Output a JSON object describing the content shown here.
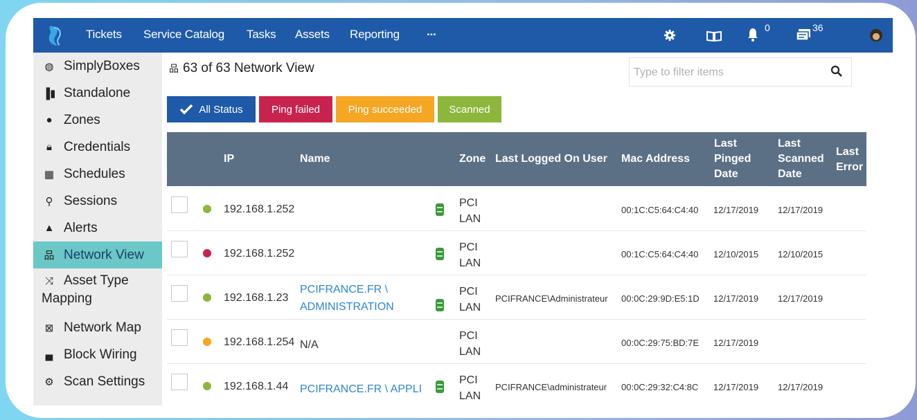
{
  "nav": {
    "items": [
      "Tickets",
      "Service Catalog",
      "Tasks",
      "Assets",
      "Reporting",
      "..."
    ],
    "notifications_count": "0",
    "messages_count": "36"
  },
  "sidebar": {
    "items": [
      {
        "label": "SimplyBoxes",
        "icon": "box-icon"
      },
      {
        "label": "Standalone",
        "icon": "standalone-icon"
      },
      {
        "label": "Zones",
        "icon": "globe-icon"
      },
      {
        "label": "Credentials",
        "icon": "lock-icon"
      },
      {
        "label": "Schedules",
        "icon": "calendar-icon"
      },
      {
        "label": "Sessions",
        "icon": "search-icon"
      },
      {
        "label": "Alerts",
        "icon": "warning-icon"
      },
      {
        "label": "Network View",
        "icon": "network-icon"
      },
      {
        "label": "Asset Type",
        "label2": "Mapping",
        "icon": "shuffle-icon"
      },
      {
        "label": "Network Map",
        "icon": "map-icon"
      },
      {
        "label": "Block Wiring",
        "icon": "switch-icon"
      },
      {
        "label": "Scan Settings",
        "icon": "gear-icon"
      }
    ],
    "active": "Network View"
  },
  "main": {
    "title": "63 of 63 Network View",
    "filter_placeholder": "Type to filter items",
    "status_buttons": [
      {
        "label": "All Status",
        "color": "#1e5aa8"
      },
      {
        "label": "Ping failed",
        "color": "#c8234e"
      },
      {
        "label": "Ping succeeded",
        "color": "#f5a623"
      },
      {
        "label": "Scanned",
        "color": "#8db63c"
      }
    ]
  },
  "table": {
    "headers": {
      "ip": "IP",
      "name": "Name",
      "zone": "Zone",
      "user": "Last Logged On User",
      "mac": "Mac Address",
      "pinged1": "Last",
      "pinged2": "Pinged",
      "pinged3": "Date",
      "scanned1": "Last",
      "scanned2": "Scanned",
      "scanned3": "Date",
      "error1": "Last",
      "error2": "Error"
    },
    "rows": [
      {
        "status_color": "#8db63c",
        "ip": "192.168.1.252",
        "name1": "",
        "name2": "",
        "zone1": "PCI",
        "zone2": "LAN",
        "user": "",
        "mac": "00:1C:C5:64:C4:40",
        "pinged": "12/17/2019",
        "scanned": "12/17/2019"
      },
      {
        "status_color": "#c8234e",
        "ip": "192.168.1.252",
        "name1": "",
        "name2": "",
        "zone1": "PCI",
        "zone2": "LAN",
        "user": "",
        "mac": "00:1C:C5:64:C4:40",
        "pinged": "12/10/2015",
        "scanned": "12/10/2015"
      },
      {
        "status_color": "#8db63c",
        "ip": "192.168.1.23",
        "name1": "PCIFRANCE.FR \\",
        "name2": "ADMINISTRATION",
        "zone1": "PCI",
        "zone2": "LAN",
        "user": "PCIFRANCE\\Administrateur",
        "mac": "00:0C:29:9D:E5:1D",
        "pinged": "12/17/2019",
        "scanned": "12/17/2019"
      },
      {
        "status_color": "#f5a623",
        "ip": "192.168.1.254",
        "name1": "N/A",
        "name2": "",
        "zone1": "PCI",
        "zone2": "LAN",
        "user": "",
        "mac": "00:0C:29:75:BD:7E",
        "pinged": "12/17/2019",
        "scanned": ""
      },
      {
        "status_color": "#8db63c",
        "ip": "192.168.1.44",
        "name1": "PCIFRANCE.FR \\ APPLI",
        "name2": "",
        "zone1": "PCI",
        "zone2": "LAN",
        "user": "PCIFRANCE\\administrateur",
        "mac": "00:0C:29:32:C4:8C",
        "pinged": "12/17/2019",
        "scanned": "12/17/2019"
      }
    ]
  }
}
